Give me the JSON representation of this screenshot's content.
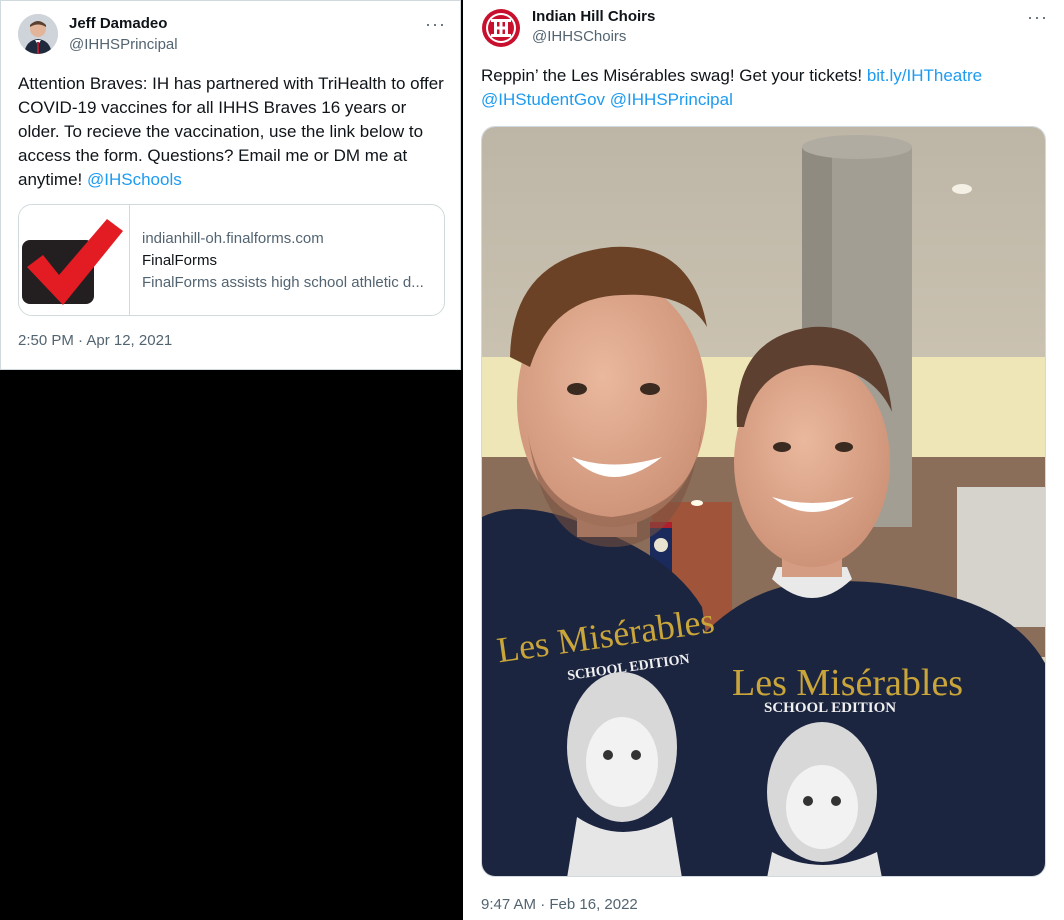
{
  "tweet_left": {
    "author_name": "Jeff Damadeo",
    "author_handle": "@IHHSPrincipal",
    "more_label": "···",
    "text": "Attention Braves: IH has partnered with TriHealth to offer COVID-19 vaccines for all IHHS Braves 16 years or older.  To recieve the vaccination, use the link below to access the form.  Questions? Email me or DM me at anytime! ",
    "mention": "@IHSchools",
    "card": {
      "domain": "indianhill-oh.finalforms.com",
      "title": "FinalForms",
      "description": "FinalForms assists high school athletic d...",
      "thumb_icon": "red-checkmark-icon"
    },
    "timestamp": "2:50 PM · Apr 12, 2021"
  },
  "tweet_right": {
    "author_name": "Indian Hill Choirs",
    "author_handle": "@IHHSChoirs",
    "more_label": "···",
    "text": "Reppin’ the Les Misérables swag! Get your tickets! ",
    "link": "bit.ly/IHTheatre",
    "mention_1": "@IHStudentGov",
    "mention_2": "@IHHSPrincipal",
    "photo": {
      "shirt_title": "Les Misérables",
      "shirt_subtitle": "SCHOOL EDITION"
    },
    "timestamp": "9:47 AM · Feb 16, 2022"
  },
  "colors": {
    "link": "#1d9bf0",
    "secondary_text": "#536471",
    "border": "#cfd9de",
    "logo_red": "#c8102e",
    "shirt_navy": "#1c2540",
    "shirt_gold": "#c9a53a"
  }
}
